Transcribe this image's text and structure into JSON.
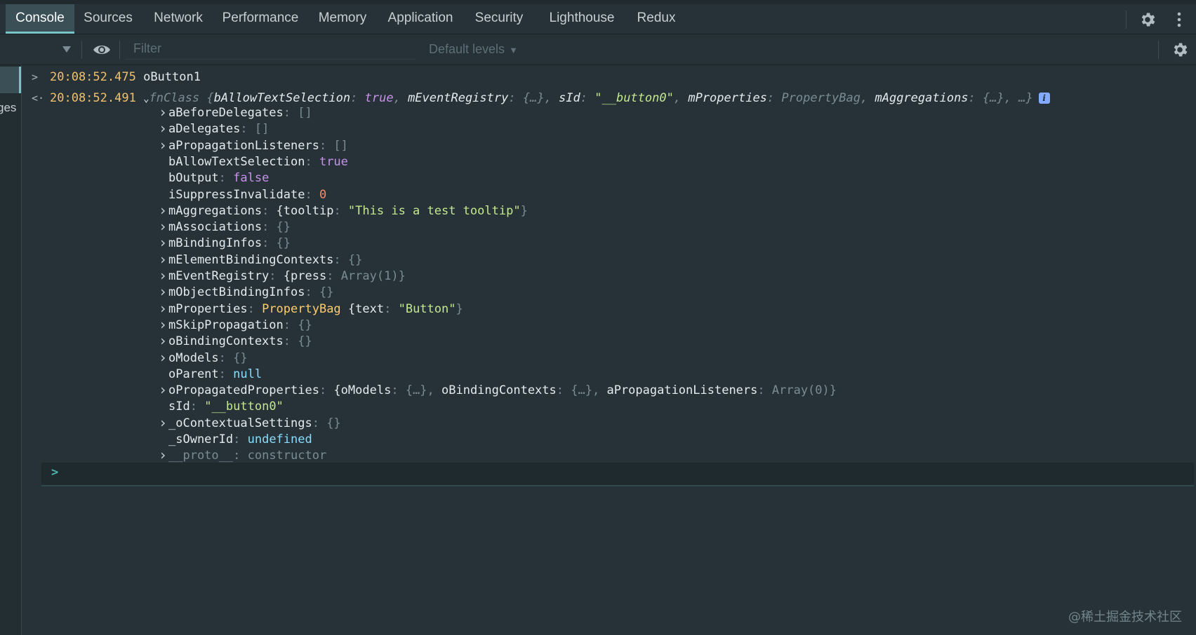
{
  "tabs": [
    {
      "label": "Console",
      "active": true
    },
    {
      "label": "Sources"
    },
    {
      "label": "Network"
    },
    {
      "label": "Performance"
    },
    {
      "label": "Memory"
    },
    {
      "label": "Application"
    },
    {
      "label": "Security"
    },
    {
      "label": "Lighthouse"
    },
    {
      "label": "Redux"
    }
  ],
  "filter": {
    "placeholder": "Filter",
    "levels": "Default levels"
  },
  "sidebar": {
    "partial_label": "ges"
  },
  "log": [
    {
      "time": "20:08:52.475",
      "text": "oButton1"
    },
    {
      "time": "20:08:52.491"
    }
  ],
  "summary": {
    "cls": "fnClass",
    "open": "{",
    "k1": "bAllowTextSelection",
    "v1": "true",
    "k2": "mEventRegistry",
    "v2": "{…}",
    "k3": "sId",
    "v3": "\"__button0\"",
    "k4": "mProperties",
    "v4": "PropertyBag",
    "k5": "mAggregations",
    "v5": "{…}",
    "tail": ", …}",
    "info": "i"
  },
  "props": [
    {
      "key": "aBeforeDelegates",
      "value": "[]",
      "type": "dim",
      "expandable": true
    },
    {
      "key": "aDelegates",
      "value": "[]",
      "type": "dim",
      "expandable": true
    },
    {
      "key": "aPropagationListeners",
      "value": "[]",
      "type": "dim",
      "expandable": true
    },
    {
      "key": "bAllowTextSelection",
      "value": "true",
      "type": "true",
      "expandable": false
    },
    {
      "key": "bOutput",
      "value": "false",
      "type": "true",
      "expandable": false
    },
    {
      "key": "iSuppressInvalidate",
      "value": "0",
      "type": "num",
      "expandable": false
    },
    {
      "key": "mAggregations",
      "expandable": true,
      "rich": "aggr"
    },
    {
      "key": "mAssociations",
      "value": "{}",
      "type": "dim",
      "expandable": true
    },
    {
      "key": "mBindingInfos",
      "value": "{}",
      "type": "dim",
      "expandable": true
    },
    {
      "key": "mElementBindingContexts",
      "value": "{}",
      "type": "dim",
      "expandable": true
    },
    {
      "key": "mEventRegistry",
      "expandable": true,
      "rich": "events"
    },
    {
      "key": "mObjectBindingInfos",
      "value": "{}",
      "type": "dim",
      "expandable": true
    },
    {
      "key": "mProperties",
      "expandable": true,
      "rich": "props"
    },
    {
      "key": "mSkipPropagation",
      "value": "{}",
      "type": "dim",
      "expandable": true
    },
    {
      "key": "oBindingContexts",
      "value": "{}",
      "type": "dim",
      "expandable": true
    },
    {
      "key": "oModels",
      "value": "{}",
      "type": "dim",
      "expandable": true
    },
    {
      "key": "oParent",
      "value": "null",
      "type": "null",
      "expandable": false
    },
    {
      "key": "oPropagatedProperties",
      "expandable": true,
      "rich": "propagated"
    },
    {
      "key": "sId",
      "value": "\"__button0\"",
      "type": "str",
      "expandable": false
    },
    {
      "key": "_oContextualSettings",
      "value": "{}",
      "type": "dim",
      "expandable": true
    },
    {
      "key": "_sOwnerId",
      "value": "undefined",
      "type": "null",
      "expandable": false
    },
    {
      "key": "__proto__",
      "value": "constructor",
      "type": "dim",
      "expandable": true,
      "dimkey": true
    }
  ],
  "rich": {
    "aggr": {
      "a": "{tooltip",
      "b": "\"This is a test tooltip\"",
      "c": "}"
    },
    "events": {
      "a": "{press",
      "b": "Array(1)",
      "c": "}"
    },
    "props": {
      "cls": "PropertyBag",
      "a": "{text",
      "b": "\"Button\"",
      "c": "}"
    },
    "propagated": {
      "a": "{oModels",
      "b": "{…}",
      "c": "oBindingContexts",
      "d": "{…}",
      "e": "aPropagationListeners",
      "f": "Array(0)",
      "g": "}"
    }
  },
  "watermark": "@稀土掘金技术社区",
  "colors": {
    "background": "#263238",
    "accent": "#79c3c7",
    "timestamp": "#f2c06b",
    "string": "#c3e88d",
    "keyword": "#c792ea",
    "number": "#f78c6c"
  }
}
